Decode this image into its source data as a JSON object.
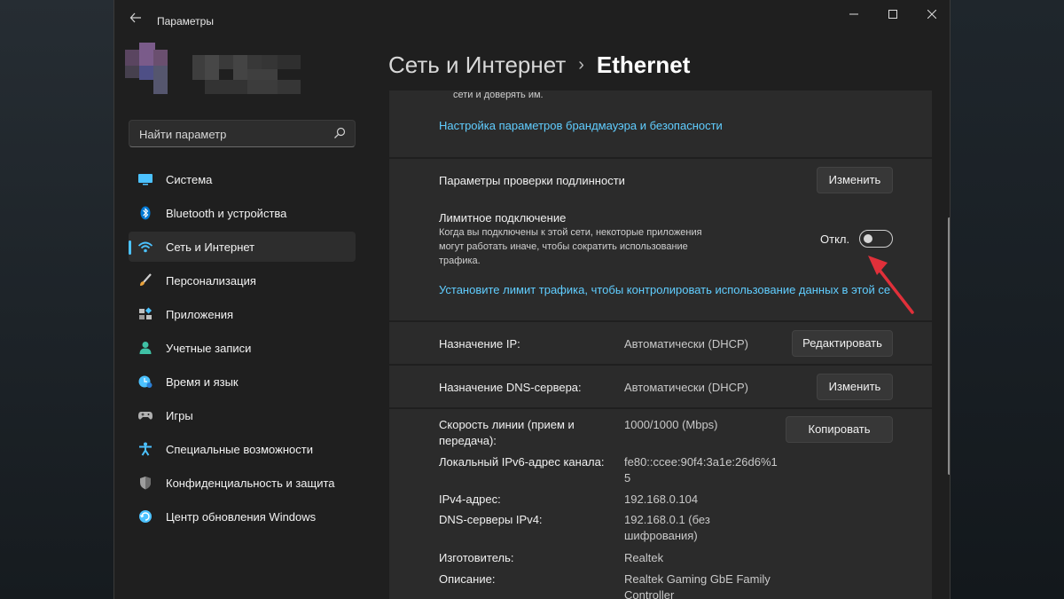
{
  "window": {
    "title": "Параметры"
  },
  "search": {
    "placeholder": "Найти параметр"
  },
  "sidebar": {
    "items": [
      {
        "label": "Система",
        "icon": "monitor-icon",
        "color": "#4cc2ff"
      },
      {
        "label": "Bluetooth и устройства",
        "icon": "bluetooth-icon",
        "color": "#0078d4"
      },
      {
        "label": "Сеть и Интернет",
        "icon": "wifi-icon",
        "color": "#4cc2ff",
        "active": true
      },
      {
        "label": "Персонализация",
        "icon": "brush-icon",
        "color": "#e8a13a"
      },
      {
        "label": "Приложения",
        "icon": "apps-icon",
        "color": "#a0a0a0"
      },
      {
        "label": "Учетные записи",
        "icon": "person-icon",
        "color": "#3fc1a5"
      },
      {
        "label": "Время и язык",
        "icon": "globe-clock-icon",
        "color": "#4cc2ff"
      },
      {
        "label": "Игры",
        "icon": "gamepad-icon",
        "color": "#b0b0b0"
      },
      {
        "label": "Специальные возможности",
        "icon": "accessibility-icon",
        "color": "#4cc2ff"
      },
      {
        "label": "Конфиденциальность и защита",
        "icon": "shield-icon",
        "color": "#9e9e9e"
      },
      {
        "label": "Центр обновления Windows",
        "icon": "update-icon",
        "color": "#4cc2ff"
      }
    ]
  },
  "breadcrumb": {
    "parent": "Сеть и Интернет",
    "separator": "›",
    "current": "Ethernet"
  },
  "firewall": {
    "cut_text": "сети и доверять им.",
    "link": "Настройка параметров брандмауэра и безопасности"
  },
  "auth": {
    "label": "Параметры проверки подлинности",
    "button": "Изменить"
  },
  "metered": {
    "title": "Лимитное подключение",
    "description": [
      "Когда вы подключены к этой сети, некоторые приложения",
      "могут работать иначе, чтобы сократить использование",
      "трафика."
    ],
    "state_label": "Откл.",
    "enabled": false,
    "link": "Установите лимит трафика, чтобы контролировать использование данных в этой се"
  },
  "ip": {
    "label": "Назначение IP:",
    "value": "Автоматически (DHCP)",
    "button": "Редактировать"
  },
  "dns": {
    "label": "Назначение DNS-сервера:",
    "value": "Автоматически (DHCP)",
    "button": "Изменить"
  },
  "props": {
    "button": "Копировать",
    "rows": [
      {
        "label": [
          "Скорость линии (прием и",
          "передача):"
        ],
        "value": [
          "1000/1000 (Mbps)"
        ]
      },
      {
        "label": [
          "Локальный IPv6-адрес канала:"
        ],
        "value": [
          "fe80::ccee:90f4:3a1e:26d6%1",
          "5"
        ]
      },
      {
        "label": [
          "IPv4-адрес:"
        ],
        "value": [
          "192.168.0.104"
        ]
      },
      {
        "label": [
          "DNS-серверы IPv4:"
        ],
        "value": [
          "192.168.0.1 (без",
          "шифрования)"
        ]
      },
      {
        "label": [
          "Изготовитель:"
        ],
        "value": [
          "Realtek"
        ]
      },
      {
        "label": [
          "Описание:"
        ],
        "value": [
          "Realtek Gaming GbE Family",
          "Controller"
        ]
      }
    ]
  },
  "colors": {
    "accent": "#4cc2ff",
    "link": "#60cdff",
    "arrow": "#e0303a"
  }
}
